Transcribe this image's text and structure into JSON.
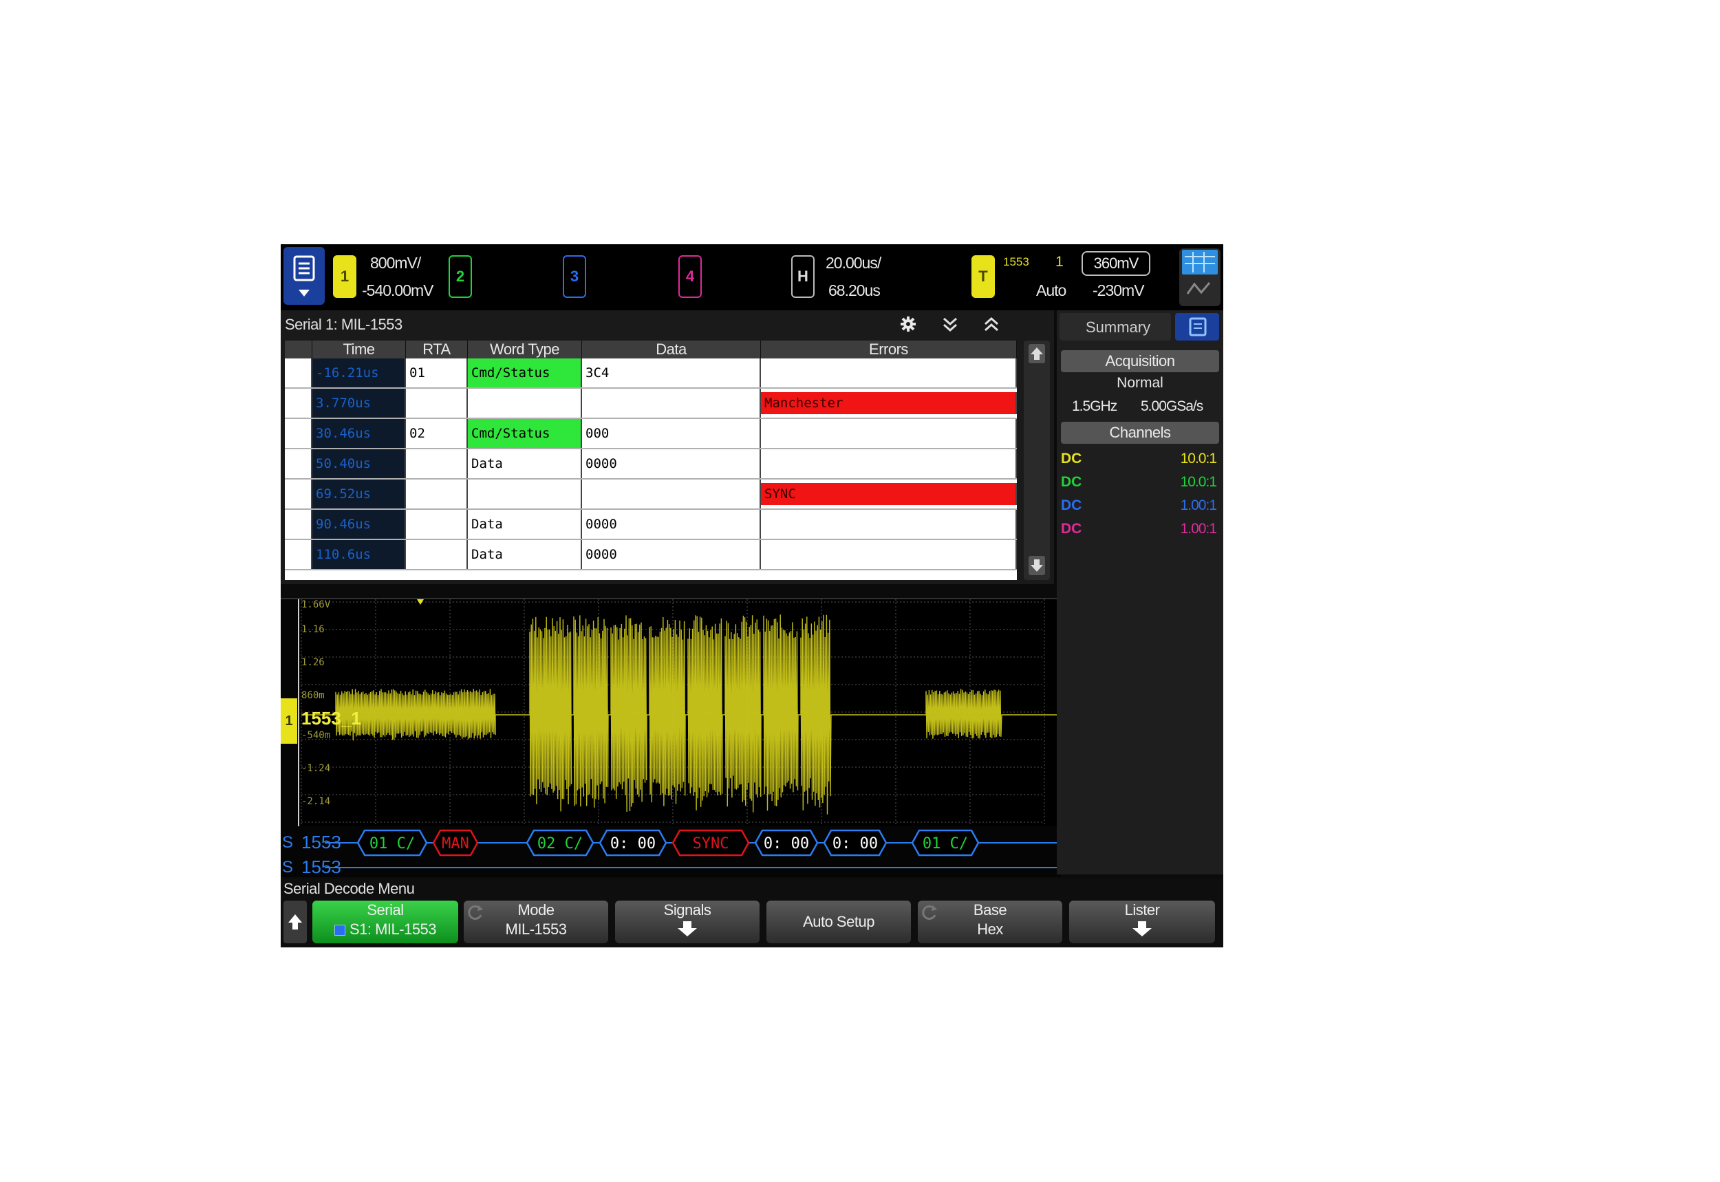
{
  "top_bar": {
    "ch1": {
      "label": "1",
      "scale": "800mV/",
      "offset": "-540.00mV",
      "color": "#e7e21a"
    },
    "ch2": {
      "label": "2",
      "color": "#1fd43a"
    },
    "ch3": {
      "label": "3",
      "color": "#2b6cf0"
    },
    "ch4": {
      "label": "4",
      "color": "#e02a9b"
    },
    "horizontal": {
      "label": "H",
      "timebase": "20.00us/",
      "delay": "68.20us"
    },
    "trigger": {
      "label": "T",
      "source": "1553",
      "channel": "1",
      "mode": "Auto",
      "level": "360mV",
      "level2": "-230mV"
    }
  },
  "serial_panel": {
    "title": "Serial 1: MIL-1553",
    "columns": [
      "Time",
      "RTA",
      "Word Type",
      "Data",
      "Errors"
    ],
    "rows": [
      {
        "time": "-16.21us",
        "rta": "01",
        "word_type": "Cmd/Status",
        "data": "3C4",
        "errors": ""
      },
      {
        "time": "3.770us",
        "rta": "",
        "word_type": "",
        "data": "",
        "errors": "Manchester"
      },
      {
        "time": "30.46us",
        "rta": "02",
        "word_type": "Cmd/Status",
        "data": "000",
        "errors": ""
      },
      {
        "time": "50.40us",
        "rta": "",
        "word_type": "Data",
        "data": "0000",
        "errors": ""
      },
      {
        "time": "69.52us",
        "rta": "",
        "word_type": "",
        "data": "",
        "errors": "SYNC"
      },
      {
        "time": "90.46us",
        "rta": "",
        "word_type": "Data",
        "data": "0000",
        "errors": ""
      },
      {
        "time": "110.6us",
        "rta": "",
        "word_type": "Data",
        "data": "0000",
        "errors": ""
      }
    ]
  },
  "waveform": {
    "axis_labels": [
      "1.66V",
      "1.16",
      "1.26",
      "",
      "",
      "-1.24",
      "-2.14"
    ],
    "marker_860": "860m",
    "marker_540": "-540m",
    "signal_label": "1553_1",
    "ch_marker": "1",
    "decode_row1_label": "1553",
    "decode_row2_label": "1553",
    "decode_prefix": "S",
    "packets": [
      {
        "text": "01 C/",
        "kind": "ok"
      },
      {
        "text": "MAN",
        "kind": "err"
      },
      {
        "text": "02 C/",
        "kind": "ok"
      },
      {
        "text": "0: 00",
        "kind": "data"
      },
      {
        "text": "SYNC",
        "kind": "err"
      },
      {
        "text": "0: 00",
        "kind": "data"
      },
      {
        "text": "0: 00",
        "kind": "data"
      },
      {
        "text": "01 C/",
        "kind": "ok"
      }
    ]
  },
  "right_panel": {
    "tab": "Summary",
    "acquisition_title": "Acquisition",
    "acq_mode": "Normal",
    "bandwidth": "1.5GHz",
    "sample_rate": "5.00GSa/s",
    "channels_title": "Channels",
    "channels": [
      {
        "coupling": "DC",
        "probe": "10.0:1",
        "color": "#e7e21a"
      },
      {
        "coupling": "DC",
        "probe": "10.0:1",
        "color": "#1fd43a"
      },
      {
        "coupling": "DC",
        "probe": "1.00:1",
        "color": "#2b6cf0"
      },
      {
        "coupling": "DC",
        "probe": "1.00:1",
        "color": "#e02a9b"
      }
    ]
  },
  "menu": {
    "title": "Serial Decode Menu",
    "buttons": [
      {
        "line1": "Serial",
        "line2": "S1: MIL-1553"
      },
      {
        "line1": "Mode",
        "line2": "MIL-1553"
      },
      {
        "line1": "Signals",
        "line2": ""
      },
      {
        "line1": "Auto Setup",
        "line2": ""
      },
      {
        "line1": "Base",
        "line2": "Hex"
      },
      {
        "line1": "Lister",
        "line2": ""
      }
    ]
  }
}
